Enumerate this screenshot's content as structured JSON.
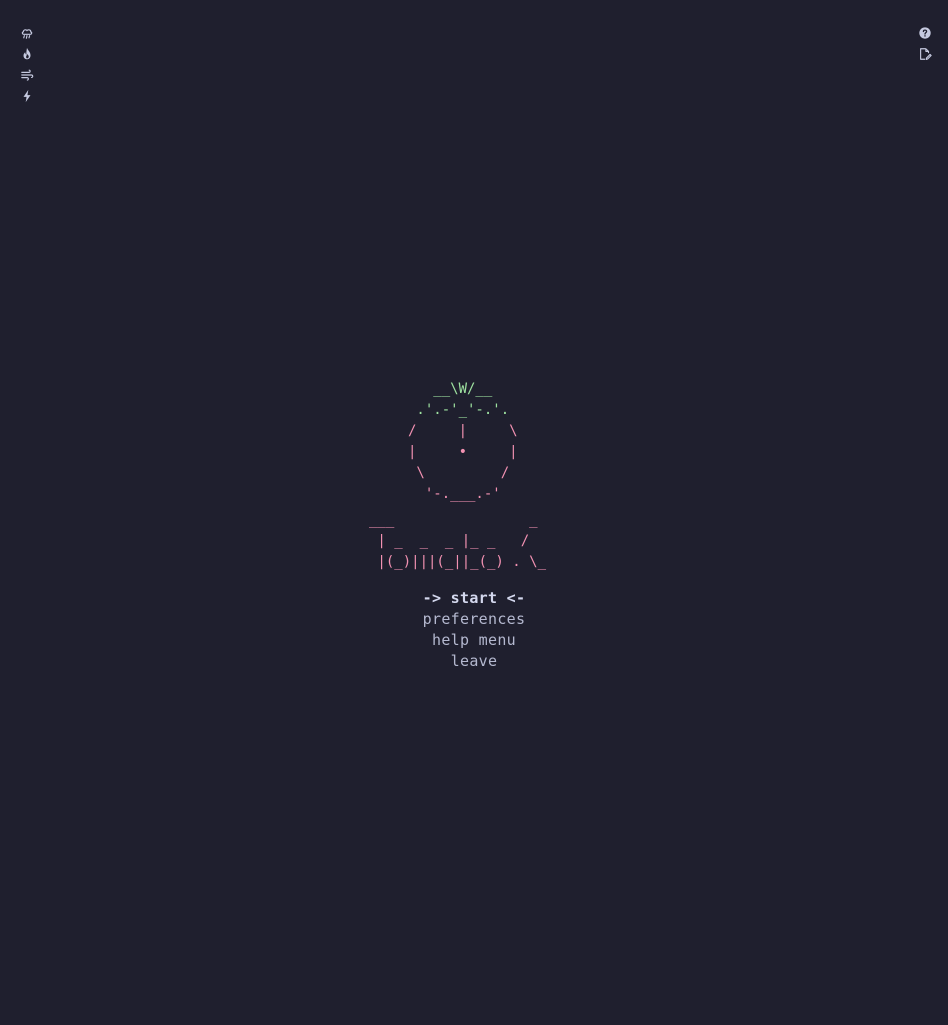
{
  "icons_left": [
    {
      "name": "rain-cloud-icon"
    },
    {
      "name": "fire-icon"
    },
    {
      "name": "wind-icon"
    },
    {
      "name": "lightning-icon"
    }
  ],
  "icons_right": [
    {
      "name": "help-icon"
    },
    {
      "name": "edit-document-icon"
    }
  ],
  "art": {
    "tomato_leaf": [
      "   __\\W/__",
      " .'.-'_'-.'."
    ],
    "tomato_body": [
      "/     |     \\",
      "|     •     |",
      " \\         /",
      "  '-.___.-'"
    ],
    "logo": [
      "___                _",
      " | _  _  _ |_ _   /",
      " |(_)|||(_||_(_) . \\_"
    ]
  },
  "menu": {
    "start": "-> start <-",
    "preferences": "preferences",
    "help": "help menu",
    "leave": "leave"
  },
  "colors": {
    "background": "#1f1f2e",
    "leaf": "#9ee2a0",
    "tomato": "#f291b2",
    "text": "#b4b8cf"
  }
}
